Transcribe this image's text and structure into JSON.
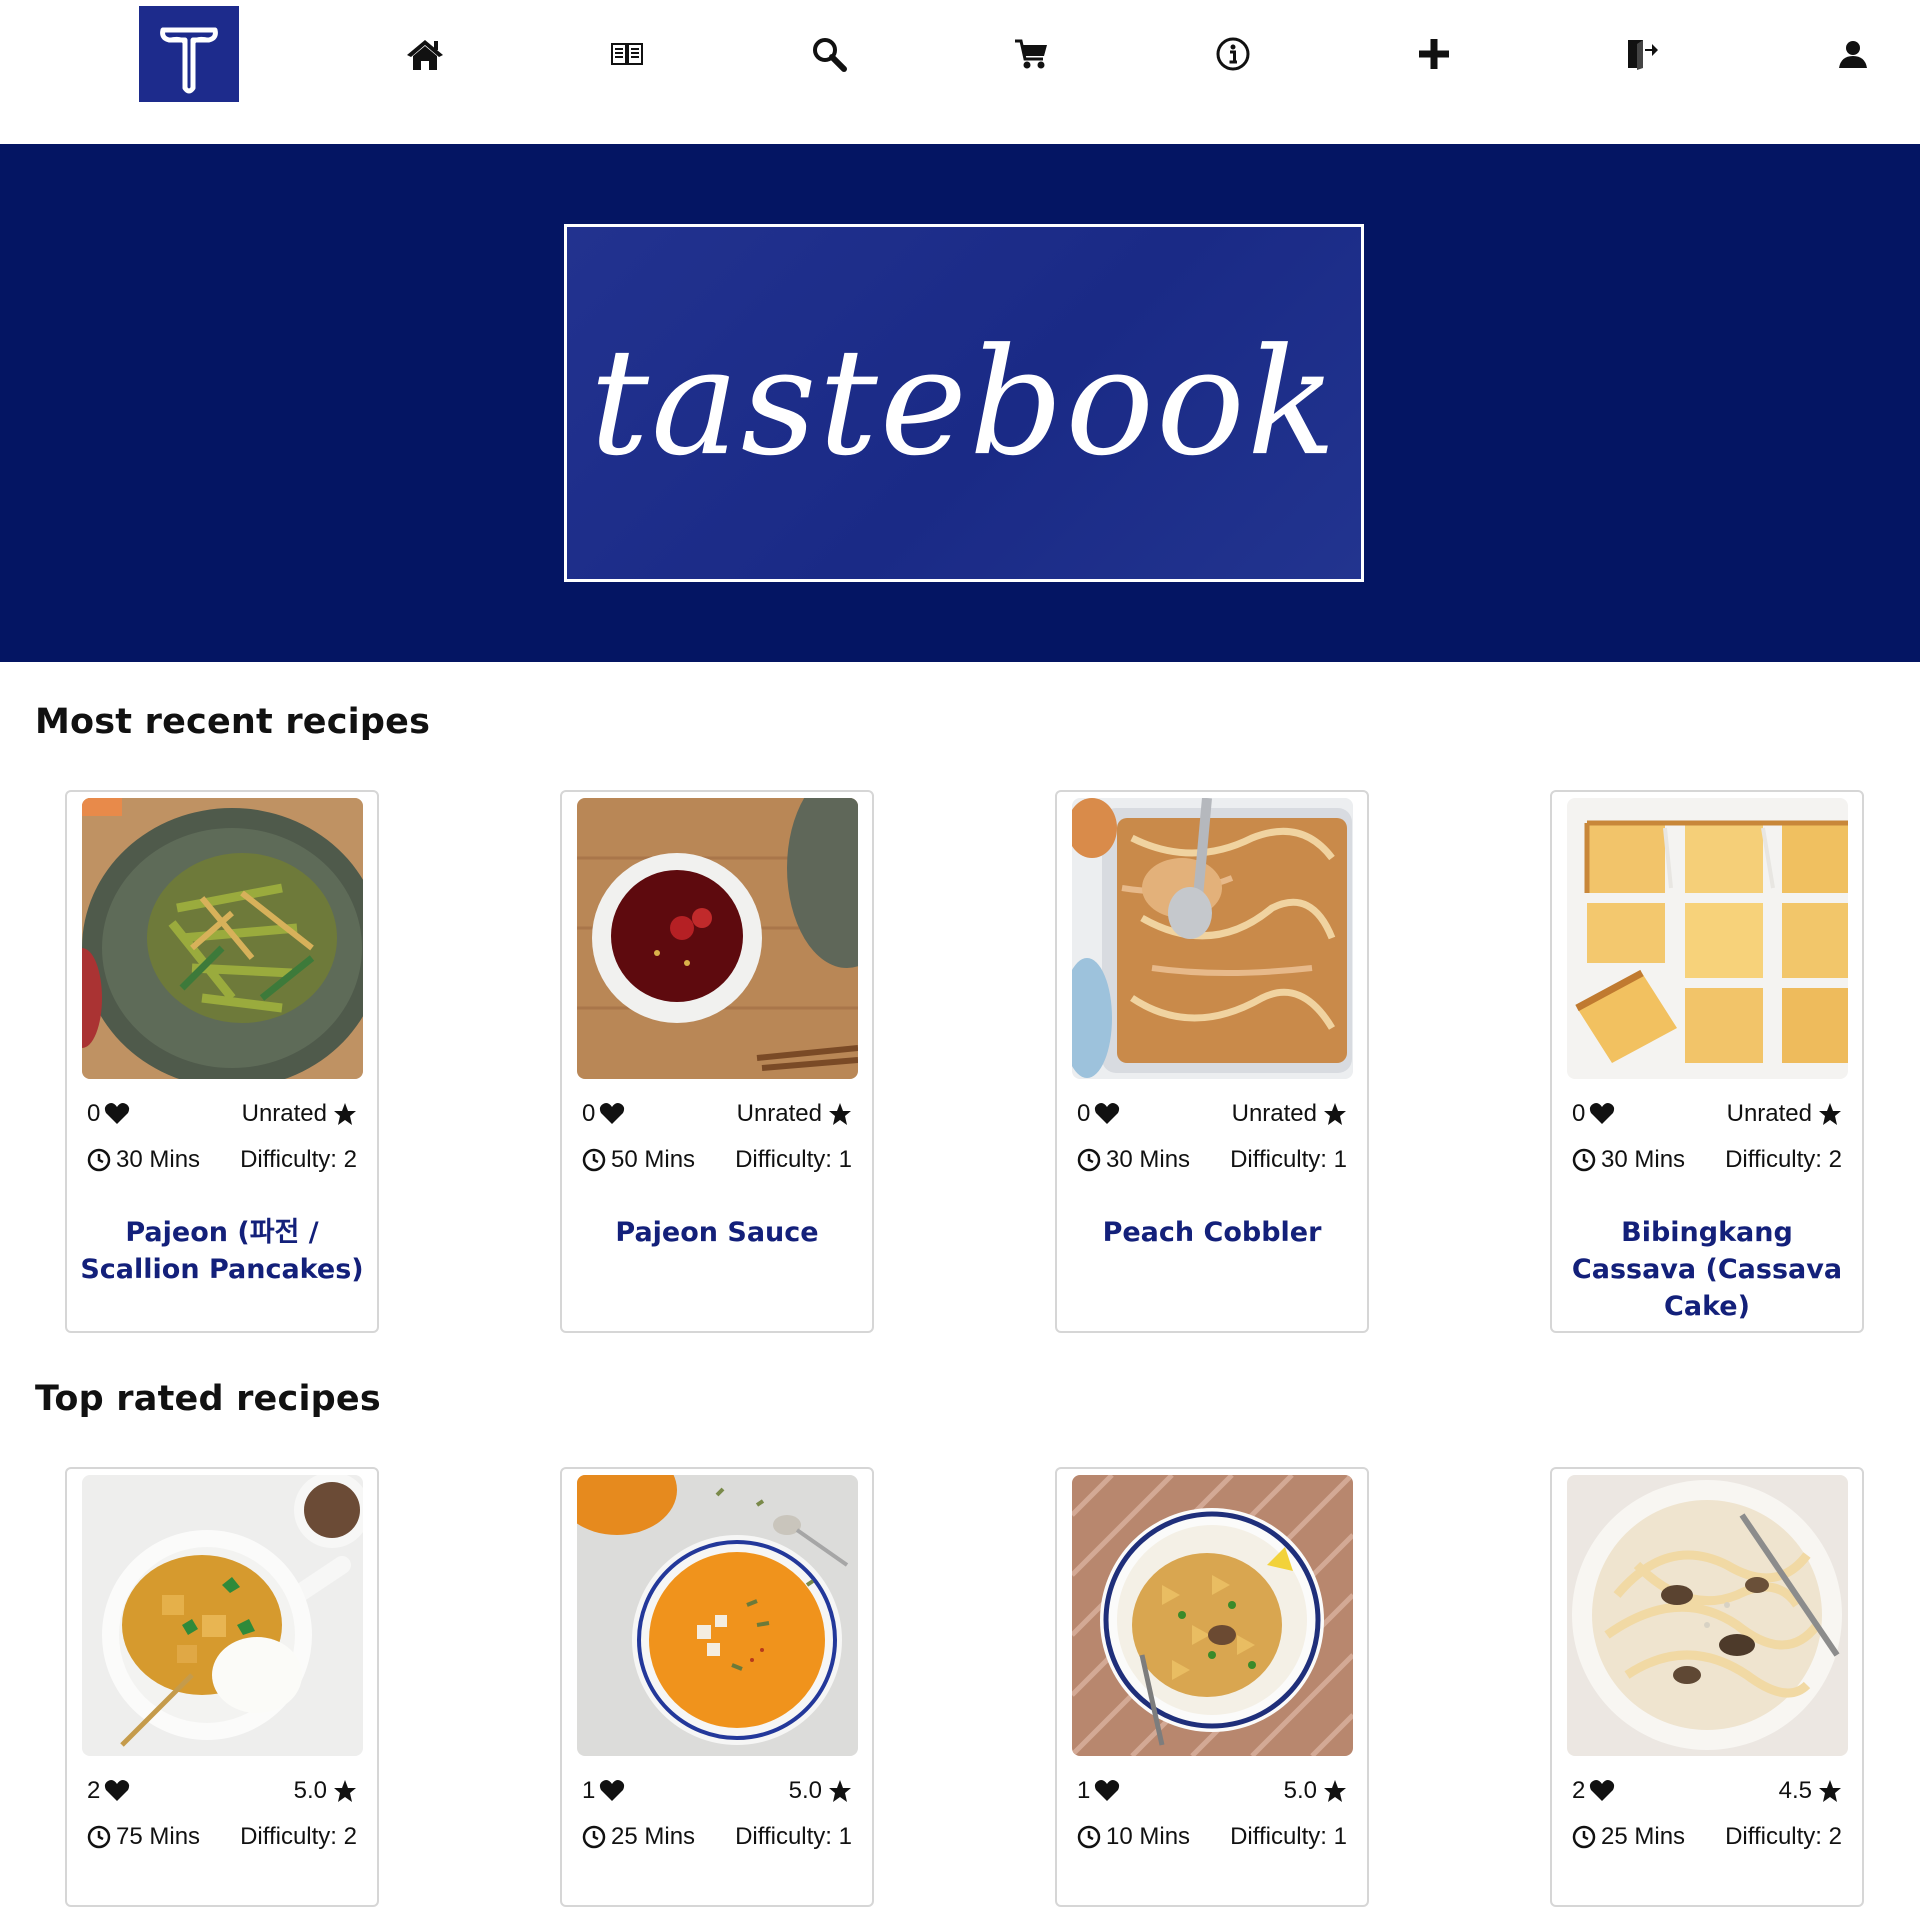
{
  "colors": {
    "brand_navy": "#041563",
    "title_blue": "#13207a",
    "card_border": "#d6d6d6"
  },
  "nav": {
    "logo_letter": "T",
    "icons": [
      "home-icon",
      "book-icon",
      "search-icon",
      "cart-icon",
      "info-icon",
      "plus-icon",
      "logout-icon",
      "user-icon"
    ]
  },
  "hero": {
    "brand_text": "tastebook"
  },
  "sections": [
    {
      "title": "Most recent recipes",
      "recipes": [
        {
          "likes": "0",
          "rating": "Unrated",
          "time": "30 Mins",
          "difficulty": "Difficulty: 2",
          "title": "Pajeon (파전 / Scallion Pancakes)",
          "image": "pajeon-photo"
        },
        {
          "likes": "0",
          "rating": "Unrated",
          "time": "50 Mins",
          "difficulty": "Difficulty: 1",
          "title": "Pajeon Sauce",
          "image": "dipping-sauce-photo"
        },
        {
          "likes": "0",
          "rating": "Unrated",
          "time": "30 Mins",
          "difficulty": "Difficulty: 1",
          "title": "Peach Cobbler",
          "image": "peach-cobbler-photo"
        },
        {
          "likes": "0",
          "rating": "Unrated",
          "time": "30 Mins",
          "difficulty": "Difficulty: 2",
          "title": "Bibingkang Cassava (Cassava Cake)",
          "image": "cassava-cake-photo"
        }
      ]
    },
    {
      "title": "Top rated recipes",
      "recipes": [
        {
          "likes": "2",
          "rating": "5.0",
          "time": "75 Mins",
          "difficulty": "Difficulty: 2",
          "image": "curry-rice-photo"
        },
        {
          "likes": "1",
          "rating": "5.0",
          "time": "25 Mins",
          "difficulty": "Difficulty: 1",
          "image": "pumpkin-soup-photo"
        },
        {
          "likes": "1",
          "rating": "5.0",
          "time": "10 Mins",
          "difficulty": "Difficulty: 1",
          "image": "farfalle-pasta-photo"
        },
        {
          "likes": "2",
          "rating": "4.5",
          "time": "25 Mins",
          "difficulty": "Difficulty: 2",
          "image": "mushroom-pasta-photo"
        }
      ]
    }
  ]
}
